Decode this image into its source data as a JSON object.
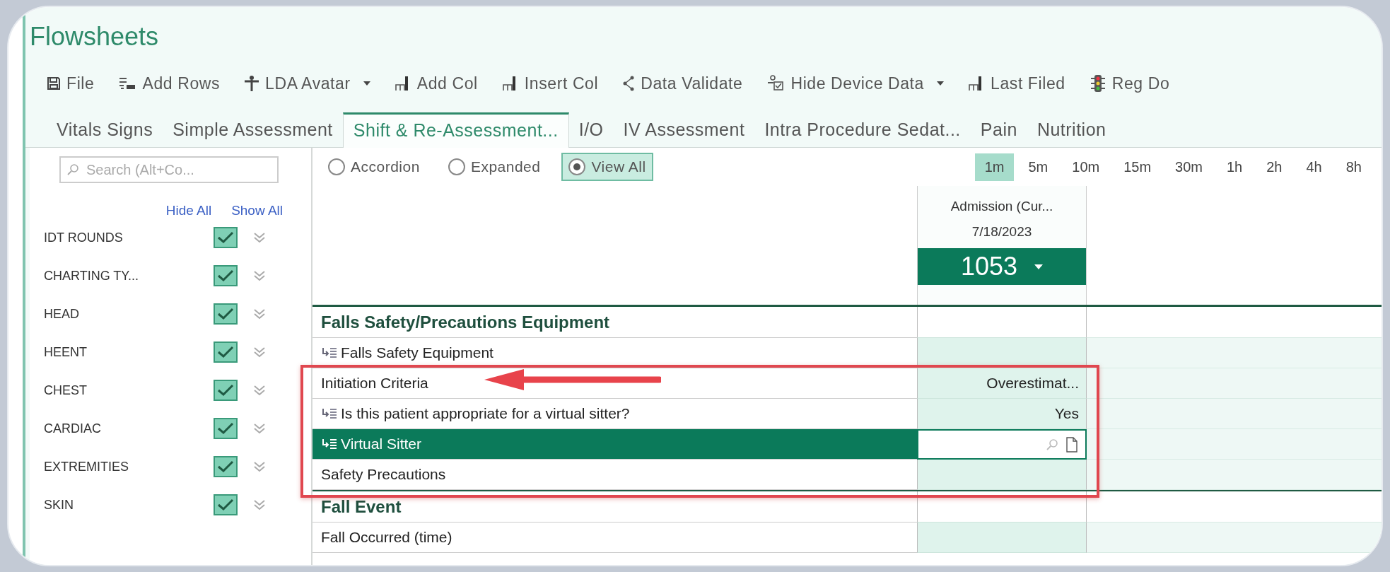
{
  "window": {
    "title": "Flowsheets"
  },
  "toolbar": [
    {
      "label": "File",
      "dropdown": false
    },
    {
      "label": "Add Rows",
      "dropdown": false
    },
    {
      "label": "LDA Avatar",
      "dropdown": true
    },
    {
      "label": "Add Col",
      "dropdown": false
    },
    {
      "label": "Insert Col",
      "dropdown": false
    },
    {
      "label": "Data Validate",
      "dropdown": false
    },
    {
      "label": "Hide Device Data",
      "dropdown": true
    },
    {
      "label": "Last Filed",
      "dropdown": false
    },
    {
      "label": "Reg Do",
      "dropdown": false
    }
  ],
  "tabs": [
    {
      "label": "Vitals Signs",
      "selected": false
    },
    {
      "label": "Simple Assessment",
      "selected": false
    },
    {
      "label": "Shift & Re-Assessment...",
      "selected": true
    },
    {
      "label": "I/O",
      "selected": false
    },
    {
      "label": "IV Assessment",
      "selected": false
    },
    {
      "label": "Intra Procedure Sedat...",
      "selected": false
    },
    {
      "label": "Pain",
      "selected": false
    },
    {
      "label": "Nutrition",
      "selected": false
    }
  ],
  "sidebar": {
    "search": {
      "placeholder": "Search (Alt+Co..."
    },
    "links": [
      "Hide All",
      "Show All"
    ],
    "items": [
      {
        "label": "IDT ROUNDS",
        "checked": true
      },
      {
        "label": "CHARTING TY...",
        "checked": true
      },
      {
        "label": "HEAD",
        "checked": true
      },
      {
        "label": "HEENT",
        "checked": true
      },
      {
        "label": "CHEST",
        "checked": true
      },
      {
        "label": "CARDIAC",
        "checked": true
      },
      {
        "label": "EXTREMITIES",
        "checked": true
      },
      {
        "label": "SKIN",
        "checked": true
      }
    ]
  },
  "view_modes": [
    {
      "label": "Accordion",
      "selected": false
    },
    {
      "label": "Expanded",
      "selected": false
    },
    {
      "label": "View All",
      "selected": true
    }
  ],
  "intervals": [
    {
      "label": "1m",
      "selected": true
    },
    {
      "label": "5m",
      "selected": false
    },
    {
      "label": "10m",
      "selected": false
    },
    {
      "label": "15m",
      "selected": false
    },
    {
      "label": "30m",
      "selected": false
    },
    {
      "label": "1h",
      "selected": false
    },
    {
      "label": "2h",
      "selected": false
    },
    {
      "label": "4h",
      "selected": false
    },
    {
      "label": "8h",
      "selected": false
    }
  ],
  "column": {
    "title": "Admission (Cur...",
    "date": "7/18/2023",
    "time": "1053"
  },
  "rows": [
    {
      "kind": "section",
      "label": "Falls Safety/Precautions Equipment"
    },
    {
      "kind": "row",
      "label": "Falls Safety Equipment",
      "icon": true,
      "selected": false
    },
    {
      "kind": "row",
      "label": "Initiation Criteria",
      "icon": false,
      "selected": false,
      "value": "Overestimat..."
    },
    {
      "kind": "row",
      "label": "Is this patient appropriate for a virtual sitter?",
      "icon": true,
      "selected": false,
      "value": "Yes"
    },
    {
      "kind": "row",
      "label": "Virtual Sitter",
      "icon": true,
      "selected": true,
      "editing": true
    },
    {
      "kind": "row",
      "label": "Safety Precautions",
      "icon": false,
      "selected": false
    },
    {
      "kind": "section",
      "label": "Fall Event"
    },
    {
      "kind": "row",
      "label": "Fall Occurred (time)",
      "icon": false,
      "selected": false
    }
  ]
}
